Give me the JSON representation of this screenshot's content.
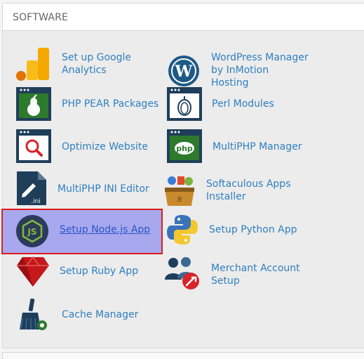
{
  "section": {
    "title": "SOFTWARE"
  },
  "items": {
    "google_analytics": "Set up Google\nAnalytics",
    "wordpress_manager": "WordPress Manager\nby InMotion\nHosting",
    "php_pear": "PHP PEAR Packages",
    "perl_modules": "Perl Modules",
    "optimize_website": "Optimize Website",
    "multiphp_manager": "MultiPHP Manager",
    "multiphp_ini": "MultiPHP INI Editor",
    "softaculous": "Softaculous Apps\nInstaller",
    "nodejs": "Setup Node.js App",
    "python": "Setup Python App",
    "ruby": "Setup Ruby App",
    "merchant": "Merchant Account\nSetup",
    "cache": "Cache Manager"
  },
  "icons": {
    "google_analytics": "google-analytics-icon",
    "wordpress_manager": "wordpress-icon",
    "php_pear": "php-pear-icon",
    "perl_modules": "perl-onion-icon",
    "optimize_website": "magnifier-icon",
    "multiphp_manager": "php-window-icon",
    "multiphp_ini": "ini-file-pencil-icon",
    "softaculous": "softaculous-box-icon",
    "nodejs": "nodejs-icon",
    "python": "python-icon",
    "ruby": "ruby-gem-icon",
    "merchant": "merchant-users-icon",
    "cache": "broom-gear-icon"
  },
  "colors": {
    "link": "#2f7fbf",
    "highlight_bg": "#a7a8ee",
    "highlight_border": "#e01b1b",
    "icon_navy": "#1f3e5a",
    "icon_green": "#2d7a2d"
  }
}
